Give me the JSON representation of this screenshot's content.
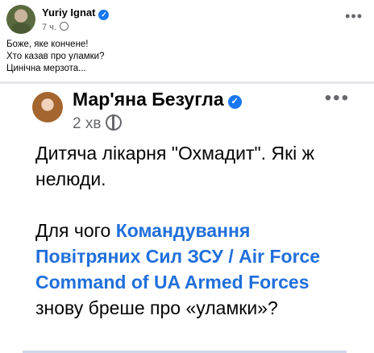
{
  "post": {
    "author": "Yuriy Ignat",
    "time": "7 ч.",
    "lines": [
      "Боже, яке кончене!",
      "Хто казав про уламки?",
      "Цинічна мерзота..."
    ]
  },
  "shared": {
    "author": "Мар'яна Безугла",
    "time": "2 хв",
    "para1": "Дитяча лікарня \"Охмадит\". Які ж нелюди.",
    "para2_before": "Для чого ",
    "para2_link": "Командування Повітряних Сил ЗСУ / Air Force Command of UA Armed Forces",
    "para2_after": " знову бреше про «уламки»?"
  },
  "icons": {
    "verified": "verified-badge-icon",
    "privacy": "globe-icon",
    "more": "more-options-icon"
  },
  "colors": {
    "link": "#216fdb",
    "badge": "#1877f2",
    "meta": "#65676b"
  }
}
